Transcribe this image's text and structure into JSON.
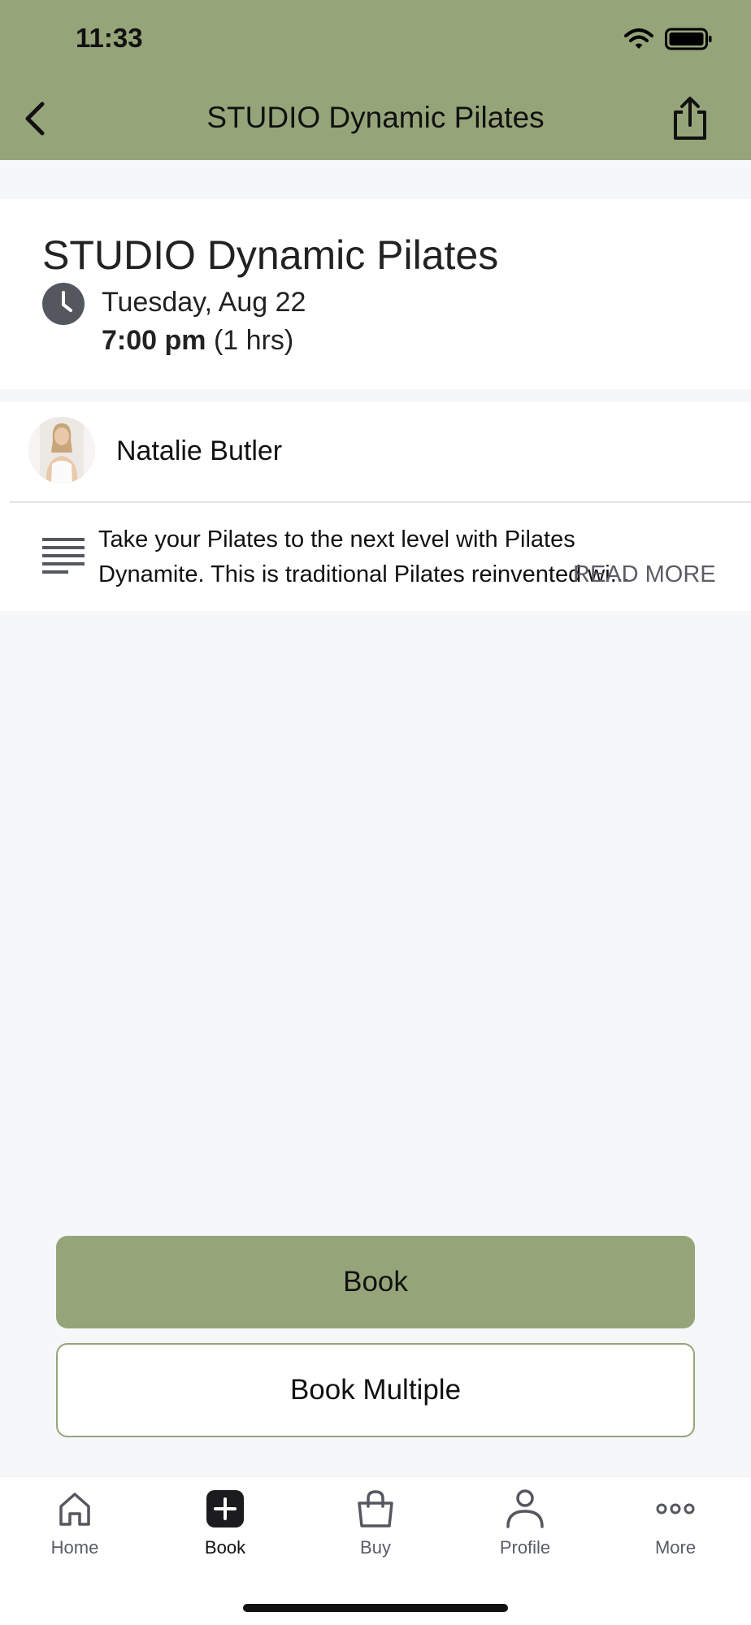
{
  "status_bar": {
    "time": "11:33"
  },
  "header": {
    "title": "STUDIO Dynamic Pilates"
  },
  "class_info": {
    "title": "STUDIO Dynamic Pilates",
    "date": "Tuesday, Aug 22",
    "time": "7:00 pm",
    "duration": "(1 hrs)"
  },
  "instructor": {
    "name": "Natalie Butler"
  },
  "description": {
    "line1": "Take your Pilates to the next level with Pilates",
    "line2": "Dynamite. This is traditional Pilates reinvented wi...",
    "read_more": "READ MORE"
  },
  "actions": {
    "book": "Book",
    "book_multiple": "Book Multiple"
  },
  "tabbar": {
    "items": [
      {
        "label": "Home",
        "icon": "home-icon"
      },
      {
        "label": "Book",
        "icon": "plus-square-icon"
      },
      {
        "label": "Buy",
        "icon": "shopping-bag-icon"
      },
      {
        "label": "Profile",
        "icon": "person-icon"
      },
      {
        "label": "More",
        "icon": "more-dots-icon"
      }
    ],
    "active": "Book"
  },
  "colors": {
    "accent": "#96a579",
    "background": "#f6f7f9"
  }
}
